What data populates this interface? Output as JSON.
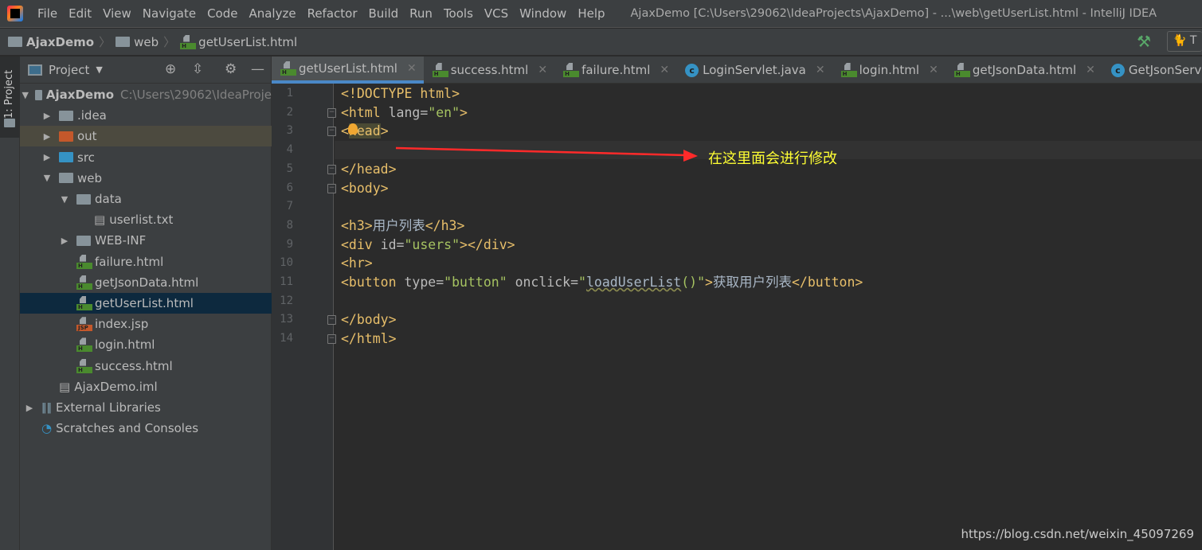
{
  "menu": {
    "items": [
      "File",
      "Edit",
      "View",
      "Navigate",
      "Code",
      "Analyze",
      "Refactor",
      "Build",
      "Run",
      "Tools",
      "VCS",
      "Window",
      "Help"
    ],
    "window_title": "AjaxDemo [C:\\Users\\29062\\IdeaProjects\\AjaxDemo] - ...\\web\\getUserList.html - IntelliJ IDEA"
  },
  "breadcrumb": [
    "AjaxDemo",
    "web",
    "getUserList.html"
  ],
  "toolbar": {
    "run_config": "T"
  },
  "sidebar": {
    "strip_label": "1: Project",
    "title": "Project",
    "tree": [
      {
        "label": "AjaxDemo",
        "path": "C:\\Users\\29062\\IdeaProje",
        "icon": "module-folder",
        "arrow": "down",
        "level": 0
      },
      {
        "label": ".idea",
        "icon": "folder",
        "arrow": "right",
        "level": 1
      },
      {
        "label": "out",
        "icon": "folder-excluded",
        "arrow": "right",
        "level": 1
      },
      {
        "label": "src",
        "icon": "folder-source",
        "arrow": "right",
        "level": 1
      },
      {
        "label": "web",
        "icon": "folder-web",
        "arrow": "down",
        "level": 1
      },
      {
        "label": "data",
        "icon": "folder",
        "arrow": "down",
        "level": 2
      },
      {
        "label": "userlist.txt",
        "icon": "text-file",
        "arrow": "",
        "level": 3
      },
      {
        "label": "WEB-INF",
        "icon": "folder",
        "arrow": "right",
        "level": 2
      },
      {
        "label": "failure.html",
        "icon": "html-file",
        "arrow": "",
        "level": 2
      },
      {
        "label": "getJsonData.html",
        "icon": "html-file",
        "arrow": "",
        "level": 2
      },
      {
        "label": "getUserList.html",
        "icon": "html-file",
        "arrow": "",
        "level": 2,
        "selected": true
      },
      {
        "label": "index.jsp",
        "icon": "jsp-file",
        "arrow": "",
        "level": 2
      },
      {
        "label": "login.html",
        "icon": "html-file",
        "arrow": "",
        "level": 2
      },
      {
        "label": "success.html",
        "icon": "html-file",
        "arrow": "",
        "level": 2
      },
      {
        "label": "AjaxDemo.iml",
        "icon": "iml-file",
        "arrow": "",
        "level": 1
      },
      {
        "label": "External Libraries",
        "icon": "libraries",
        "arrow": "right",
        "level": 0
      },
      {
        "label": "Scratches and Consoles",
        "icon": "scratches",
        "arrow": "",
        "level": 0
      }
    ]
  },
  "tabs": [
    {
      "label": "getUserList.html",
      "icon": "html-file",
      "active": true
    },
    {
      "label": "success.html",
      "icon": "html-file"
    },
    {
      "label": "failure.html",
      "icon": "html-file"
    },
    {
      "label": "LoginServlet.java",
      "icon": "java-class"
    },
    {
      "label": "login.html",
      "icon": "html-file"
    },
    {
      "label": "getJsonData.html",
      "icon": "html-file"
    },
    {
      "label": "GetJsonServlet.java",
      "icon": "java-class"
    }
  ],
  "editor": {
    "current_line": 4,
    "lines": [
      [
        {
          "t": "<!DOCTYPE html>",
          "c": "tag"
        }
      ],
      [
        {
          "t": "<html ",
          "c": "tag"
        },
        {
          "t": "lang=",
          "c": "attr"
        },
        {
          "t": "\"en\"",
          "c": "val"
        },
        {
          "t": ">",
          "c": "tag"
        }
      ],
      [
        {
          "t": "<",
          "c": "tag"
        },
        {
          "t": "head",
          "c": "tag hl"
        },
        {
          "t": ">",
          "c": "tag"
        }
      ],
      [],
      [
        {
          "t": "</head>",
          "c": "tag"
        }
      ],
      [
        {
          "t": "<body>",
          "c": "tag"
        }
      ],
      [],
      [
        {
          "t": "<h3>",
          "c": "tag"
        },
        {
          "t": "用户列表",
          "c": "text"
        },
        {
          "t": "</h3>",
          "c": "tag"
        }
      ],
      [
        {
          "t": "<div ",
          "c": "tag"
        },
        {
          "t": "id=",
          "c": "attr"
        },
        {
          "t": "\"users\"",
          "c": "val"
        },
        {
          "t": "></div>",
          "c": "tag"
        }
      ],
      [
        {
          "t": "<hr>",
          "c": "tag"
        }
      ],
      [
        {
          "t": "<button ",
          "c": "tag"
        },
        {
          "t": "type=",
          "c": "attr"
        },
        {
          "t": "\"button\" ",
          "c": "val"
        },
        {
          "t": "onclick=",
          "c": "attr"
        },
        {
          "t": "\"",
          "c": "val"
        },
        {
          "t": "loadUserList",
          "c": "text wavy"
        },
        {
          "t": "()\"",
          "c": "val"
        },
        {
          "t": ">",
          "c": "tag"
        },
        {
          "t": "获取用户列表",
          "c": "text"
        },
        {
          "t": "</button>",
          "c": "tag"
        }
      ],
      [],
      [
        {
          "t": "</body>",
          "c": "tag"
        }
      ],
      [
        {
          "t": "</html>",
          "c": "tag"
        }
      ]
    ]
  },
  "annotation": {
    "text": "在这里面会进行修改",
    "color": "#ff2a2a"
  },
  "watermark": "https://blog.csdn.net/weixin_45097269"
}
